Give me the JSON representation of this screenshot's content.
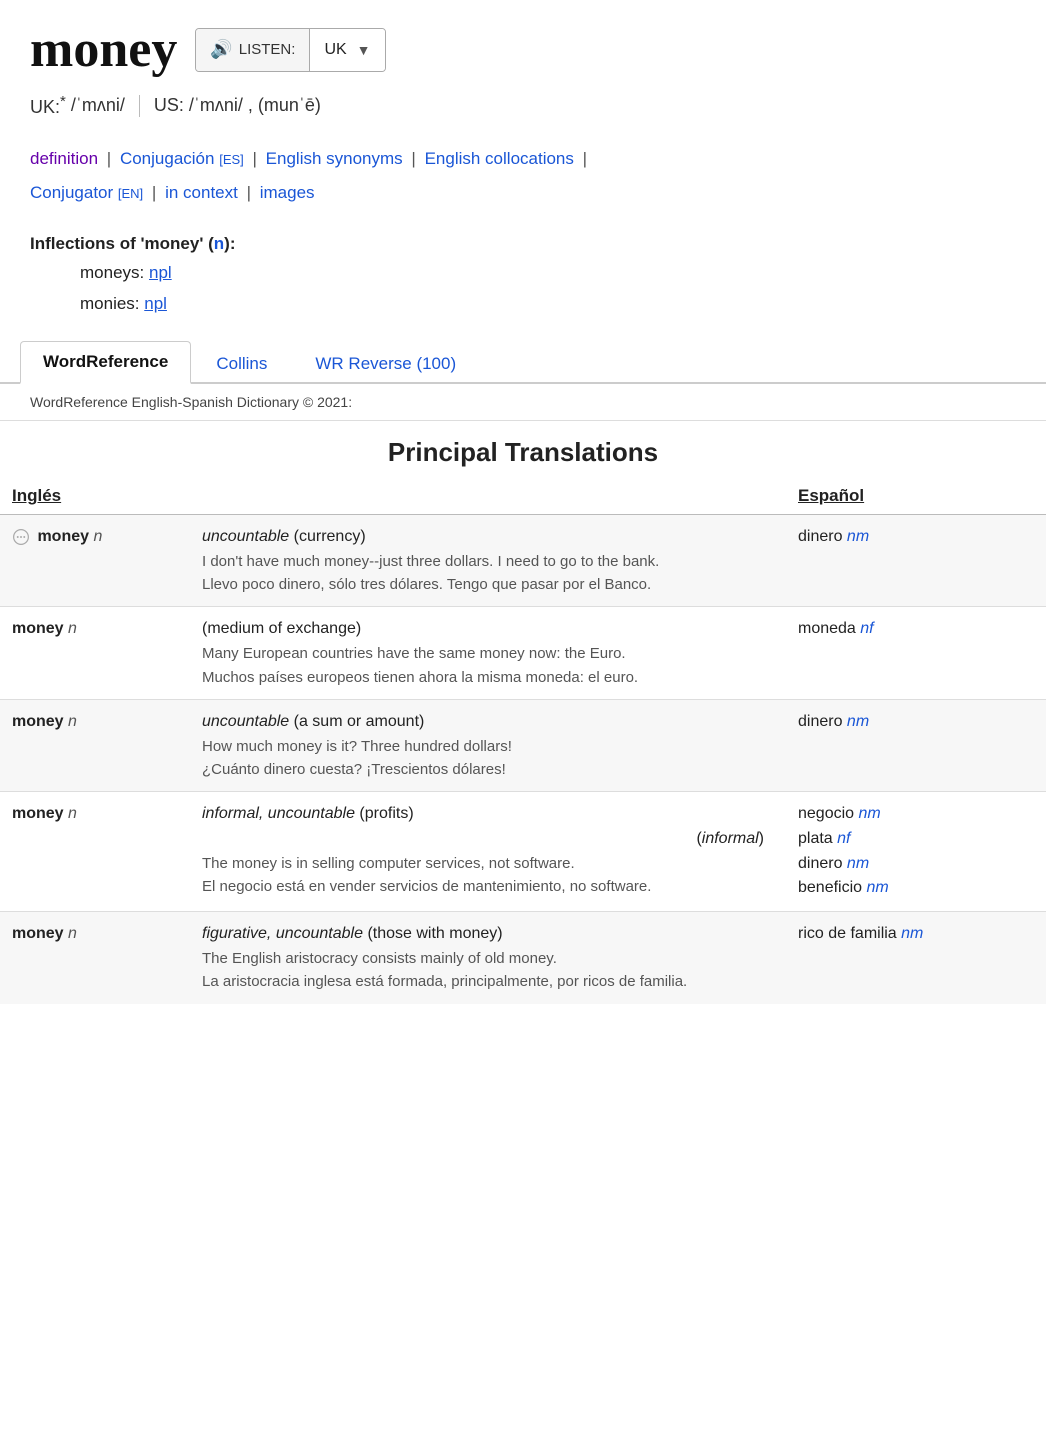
{
  "header": {
    "word": "money",
    "listen_label": "LISTEN:",
    "locale": "UK"
  },
  "pronunciation": {
    "uk_label": "UK:",
    "uk_star": "*",
    "uk_ipa": "/ˈmʌni/",
    "us_label": "US:",
    "us_ipa": "/ˈmʌni/ ,  (munˈē)"
  },
  "links": [
    {
      "text": "definition",
      "class": "link-purple"
    },
    {
      "text": "Conjugación",
      "tag": "[ES]",
      "class": "link-blue"
    },
    {
      "text": "English synonyms",
      "class": "link-blue"
    },
    {
      "text": "English collocations",
      "class": "link-blue"
    },
    {
      "text": "Conjugator",
      "tag": "[EN]",
      "class": "link-blue"
    },
    {
      "text": "in context",
      "class": "link-blue"
    },
    {
      "text": "images",
      "class": "link-blue"
    }
  ],
  "inflections": {
    "prefix": "Inflections of '",
    "word": "money",
    "suffix": "' (n):",
    "items": [
      {
        "label": "moneys:",
        "link": "npl"
      },
      {
        "label": "monies:",
        "link": "npl"
      }
    ]
  },
  "tabs": [
    {
      "label": "WordReference",
      "active": true
    },
    {
      "label": "Collins",
      "active": false
    },
    {
      "label": "WR Reverse (100)",
      "active": false
    }
  ],
  "dict_credit": "WordReference English-Spanish Dictionary © 2021:",
  "principal_translations_title": "Principal Translations",
  "col_en": "Inglés",
  "col_es": "Español",
  "rows": [
    {
      "en_word": "money",
      "en_pos": "n",
      "has_icon": true,
      "definition": "uncountable (currency)",
      "es_word": "dinero",
      "es_pos": "nm",
      "example_en": "I don't have much money--just three dollars. I need to go to the bank.",
      "example_es": "Llevo poco dinero, sólo tres dólares. Tengo que pasar por el Banco.",
      "shaded": true
    },
    {
      "en_word": "money",
      "en_pos": "n",
      "has_icon": false,
      "definition": "(medium of exchange)",
      "es_word": "moneda",
      "es_pos": "nf",
      "example_en": "Many European countries have the same money now: the Euro.",
      "example_es": "Muchos países europeos tienen ahora la misma moneda: el euro.",
      "shaded": false
    },
    {
      "en_word": "money",
      "en_pos": "n",
      "has_icon": false,
      "definition": "uncountable (a sum or amount)",
      "es_word": "dinero",
      "es_pos": "nm",
      "example_en": "How much money is it? Three hundred dollars!",
      "example_es": "¿Cuánto dinero cuesta? ¡Trescientos dólares!",
      "shaded": true
    },
    {
      "en_word": "money",
      "en_pos": "n",
      "has_icon": false,
      "definition": "informal, uncountable (profits)",
      "definition2": "(informal)",
      "es_word": "negocio",
      "es_pos": "nm",
      "es_word2": "plata",
      "es_pos2": "nf",
      "es_word3": "dinero",
      "es_pos3": "nm",
      "es_word4": "beneficio",
      "es_pos4": "nm",
      "example_en": "The money is in selling computer services, not software.",
      "example_es": "El negocio está en vender servicios de mantenimiento, no software.",
      "shaded": false,
      "multi_translation": true
    },
    {
      "en_word": "money",
      "en_pos": "n",
      "has_icon": false,
      "definition": "figurative, uncountable (those with money)",
      "es_word": "rico de familia",
      "es_pos": "nm",
      "example_en": "The English aristocracy consists mainly of old money.",
      "example_es": "La aristocracia inglesa está formada, principalmente, por ricos de familia.",
      "shaded": true
    }
  ]
}
